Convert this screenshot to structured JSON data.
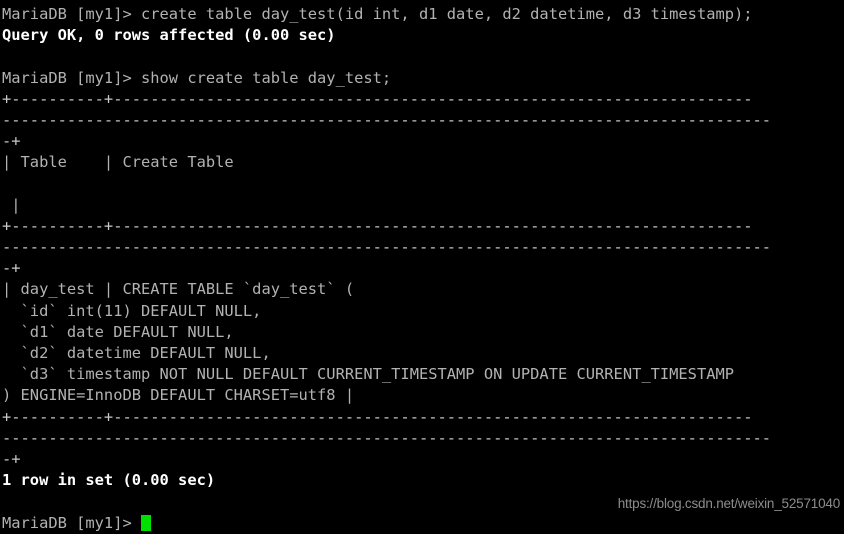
{
  "terminal": {
    "title": "MariaDB [my1] session",
    "columns": 84,
    "rows": 25,
    "background_color": "#000000",
    "foreground_color": "#b2b2b2",
    "bold_color": "#ffffff",
    "cursor_color": "#00e000",
    "prompt": "MariaDB [my1]> "
  },
  "lines": {
    "l01": "MariaDB [my1]> create table day_test(id int, d1 date, d2 datetime, d3 timestamp);",
    "l02": "Query OK, 0 rows affected (0.00 sec)",
    "l03": "",
    "l04": "MariaDB [my1]> show create table day_test;",
    "l05": "+----------+---------------------------------------------------------------------",
    "l06": "-----------------------------------------------------------------------------------",
    "l07": "-+",
    "l08": "| Table    | Create Table",
    "l09": "",
    "l10": " |",
    "l11": "+----------+---------------------------------------------------------------------",
    "l12": "-----------------------------------------------------------------------------------",
    "l13": "-+",
    "l14": "| day_test | CREATE TABLE `day_test` (",
    "l15": "  `id` int(11) DEFAULT NULL,",
    "l16": "  `d1` date DEFAULT NULL,",
    "l17": "  `d2` datetime DEFAULT NULL,",
    "l18": "  `d3` timestamp NOT NULL DEFAULT CURRENT_TIMESTAMP ON UPDATE CURRENT_TIMESTAMP",
    "l19": ") ENGINE=InnoDB DEFAULT CHARSET=utf8 |",
    "l20": "+----------+---------------------------------------------------------------------",
    "l21": "-----------------------------------------------------------------------------------",
    "l22": "-+",
    "l23": "1 row in set (0.00 sec)",
    "l24": "",
    "l25_prompt": "MariaDB [my1]> "
  },
  "commands": [
    "create table day_test(id int, d1 date, d2 datetime, d3 timestamp);",
    "show create table day_test;"
  ],
  "results": {
    "create_status": "Query OK, 0 rows affected (0.00 sec)",
    "select_status": "1 row in set (0.00 sec)",
    "table_headers": [
      "Table",
      "Create Table"
    ],
    "table_row": {
      "Table": "day_test",
      "Create Table": "CREATE TABLE `day_test` (\n  `id` int(11) DEFAULT NULL,\n  `d1` date DEFAULT NULL,\n  `d2` datetime DEFAULT NULL,\n  `d3` timestamp NOT NULL DEFAULT CURRENT_TIMESTAMP ON UPDATE CURRENT_TIMESTAMP\n) ENGINE=InnoDB DEFAULT CHARSET=utf8"
    }
  },
  "watermark": {
    "text": "https://blog.csdn.net/weixin_52571040",
    "color": "#8c8c8c"
  }
}
